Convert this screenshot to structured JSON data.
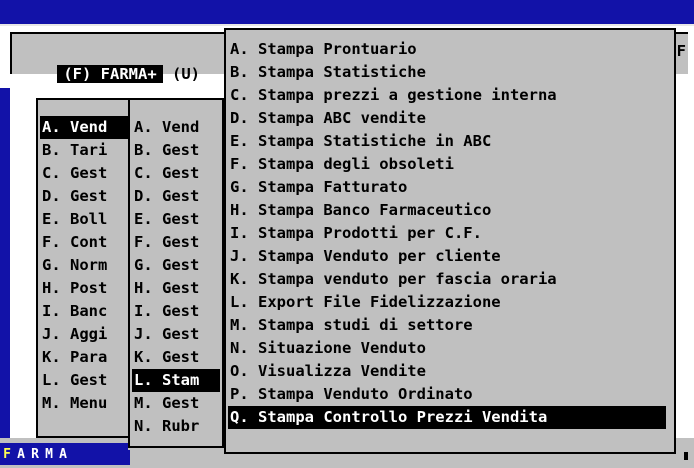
{
  "header": {
    "app_badge": "(F) FARMA+",
    "tag": "(U)",
    "right_char": "F"
  },
  "status": {
    "letters": [
      "F",
      "A",
      "R",
      "M",
      "A"
    ]
  },
  "main_menu": {
    "items": [
      {
        "label": "A. Vend"
      },
      {
        "label": "B. Tari"
      },
      {
        "label": "C. Gest"
      },
      {
        "label": "D. Gest"
      },
      {
        "label": "E. Boll"
      },
      {
        "label": "F. Cont"
      },
      {
        "label": "G. Norm"
      },
      {
        "label": "H. Post"
      },
      {
        "label": "I. Banc"
      },
      {
        "label": "J. Aggi"
      },
      {
        "label": "K. Para"
      },
      {
        "label": "L. Gest"
      },
      {
        "label": "M. Menu"
      }
    ]
  },
  "sub_menu": {
    "items": [
      {
        "label": "A. Vend"
      },
      {
        "label": "B. Gest"
      },
      {
        "label": "C. Gest"
      },
      {
        "label": "D. Gest"
      },
      {
        "label": "E. Gest"
      },
      {
        "label": "F. Gest"
      },
      {
        "label": "G. Gest"
      },
      {
        "label": "H. Gest"
      },
      {
        "label": "I. Gest"
      },
      {
        "label": "J. Gest"
      },
      {
        "label": "K. Gest"
      },
      {
        "label": "L. Stam"
      },
      {
        "label": "M. Gest"
      },
      {
        "label": "N. Rubr"
      }
    ]
  },
  "print_menu": {
    "items": [
      {
        "label": "A. Stampa Prontuario"
      },
      {
        "label": "B. Stampa Statistiche"
      },
      {
        "label": "C. Stampa prezzi a gestione interna"
      },
      {
        "label": "D. Stampa ABC vendite"
      },
      {
        "label": "E. Stampa Statistiche in ABC"
      },
      {
        "label": "F. Stampa degli obsoleti"
      },
      {
        "label": "G. Stampa Fatturato"
      },
      {
        "label": "H. Stampa Banco Farmaceutico"
      },
      {
        "label": "I. Stampa Prodotti per C.F."
      },
      {
        "label": "J. Stampa Venduto per cliente"
      },
      {
        "label": "K. Stampa venduto per fascia oraria"
      },
      {
        "label": "L. Export File Fidelizzazione"
      },
      {
        "label": "M. Stampa studi di settore"
      },
      {
        "label": "N. Situazione Venduto"
      },
      {
        "label": "O. Visualizza Vendite"
      },
      {
        "label": "P. Stampa Venduto Ordinato"
      },
      {
        "label": "Q. Stampa Controllo Prezzi Vendita"
      }
    ]
  },
  "colors": {
    "background_blue": "#1212a8",
    "menu_gray": "#c0c0c0",
    "highlight": "#000000"
  }
}
